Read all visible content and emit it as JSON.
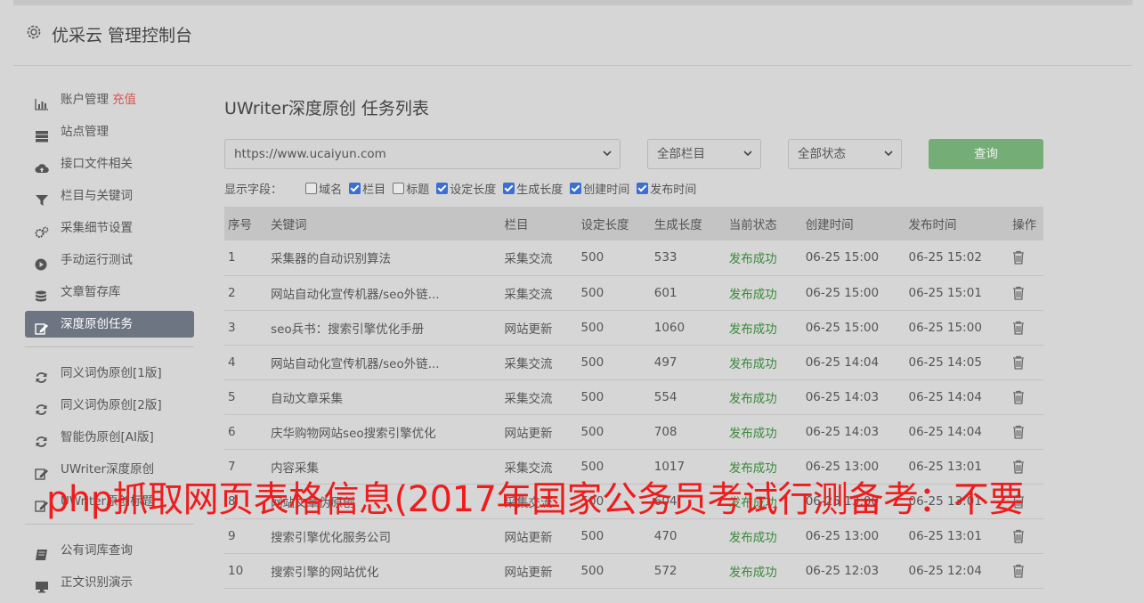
{
  "header": {
    "title": "优采云 管理控制台"
  },
  "sidebar": {
    "items": [
      {
        "label": "账户管理",
        "tag": "充值",
        "icon": "bar-chart-icon"
      },
      {
        "label": "站点管理",
        "icon": "server-icon"
      },
      {
        "label": "接口文件相关",
        "icon": "cloud-upload-icon"
      },
      {
        "label": "栏目与关键词",
        "icon": "filter-icon"
      },
      {
        "label": "采集细节设置",
        "icon": "gears-icon"
      },
      {
        "label": "手动运行测试",
        "icon": "play-circle-icon"
      },
      {
        "label": "文章暂存库",
        "icon": "database-icon"
      },
      {
        "label": "深度原创任务",
        "icon": "edit-icon",
        "active": true
      }
    ],
    "group2": [
      {
        "label": "同义词伪原创[1版]",
        "icon": "refresh-icon"
      },
      {
        "label": "同义词伪原创[2版]",
        "icon": "refresh-icon"
      },
      {
        "label": "智能伪原创[AI版]",
        "icon": "refresh-icon"
      },
      {
        "label": "UWriter深度原创",
        "icon": "edit-icon"
      },
      {
        "label": "UWriter原创标题",
        "icon": "edit-icon"
      }
    ],
    "group3": [
      {
        "label": "公有词库查询",
        "icon": "book-icon"
      },
      {
        "label": "正文识别演示",
        "icon": "monitor-icon"
      }
    ]
  },
  "main": {
    "title": "UWriter深度原创 任务列表",
    "site_select": "https://www.ucaiyun.com",
    "column_select": "全部栏目",
    "status_select": "全部状态",
    "query_button": "查询",
    "fields_label": "显示字段：",
    "fields": [
      {
        "label": "域名",
        "checked": false
      },
      {
        "label": "栏目",
        "checked": true
      },
      {
        "label": "标题",
        "checked": false
      },
      {
        "label": "设定长度",
        "checked": true
      },
      {
        "label": "生成长度",
        "checked": true
      },
      {
        "label": "创建时间",
        "checked": true
      },
      {
        "label": "发布时间",
        "checked": true
      }
    ],
    "table": {
      "headers": [
        "序号",
        "关键词",
        "栏目",
        "设定长度",
        "生成长度",
        "当前状态",
        "创建时间",
        "发布时间",
        "操作"
      ],
      "rows": [
        [
          "1",
          "采集器的自动识别算法",
          "采集交流",
          "500",
          "533",
          "发布成功",
          "06-25 15:00",
          "06-25 15:02"
        ],
        [
          "2",
          "网站自动化宣传机器/seo外链...",
          "采集交流",
          "500",
          "601",
          "发布成功",
          "06-25 15:00",
          "06-25 15:01"
        ],
        [
          "3",
          "seo兵书：搜索引擎优化手册",
          "网站更新",
          "500",
          "1060",
          "发布成功",
          "06-25 15:00",
          "06-25 15:00"
        ],
        [
          "4",
          "网站自动化宣传机器/seo外链...",
          "采集交流",
          "500",
          "497",
          "发布成功",
          "06-25 14:04",
          "06-25 14:05"
        ],
        [
          "5",
          "自动文章采集",
          "采集交流",
          "500",
          "554",
          "发布成功",
          "06-25 14:03",
          "06-25 14:04"
        ],
        [
          "6",
          "庆华购物网站seo搜索引擎优化",
          "网站更新",
          "500",
          "708",
          "发布成功",
          "06-25 14:03",
          "06-25 14:04"
        ],
        [
          "7",
          "内容采集",
          "采集交流",
          "500",
          "1017",
          "发布成功",
          "06-25 13:00",
          "06-25 13:01"
        ],
        [
          "8",
          "网站文章伪原创",
          "采集交流",
          "500",
          "604",
          "发布成功",
          "06-25 13:00",
          "06-25 13:01"
        ],
        [
          "9",
          "搜索引擎优化服务公司",
          "网站更新",
          "500",
          "470",
          "发布成功",
          "06-25 13:00",
          "06-25 13:01"
        ],
        [
          "10",
          "搜索引擎的网站优化",
          "网站更新",
          "500",
          "572",
          "发布成功",
          "06-25 12:03",
          "06-25 12:04"
        ]
      ]
    }
  },
  "watermark": "php抓取网页表格信息(2017年国家公务员考试行测备考：不要"
}
